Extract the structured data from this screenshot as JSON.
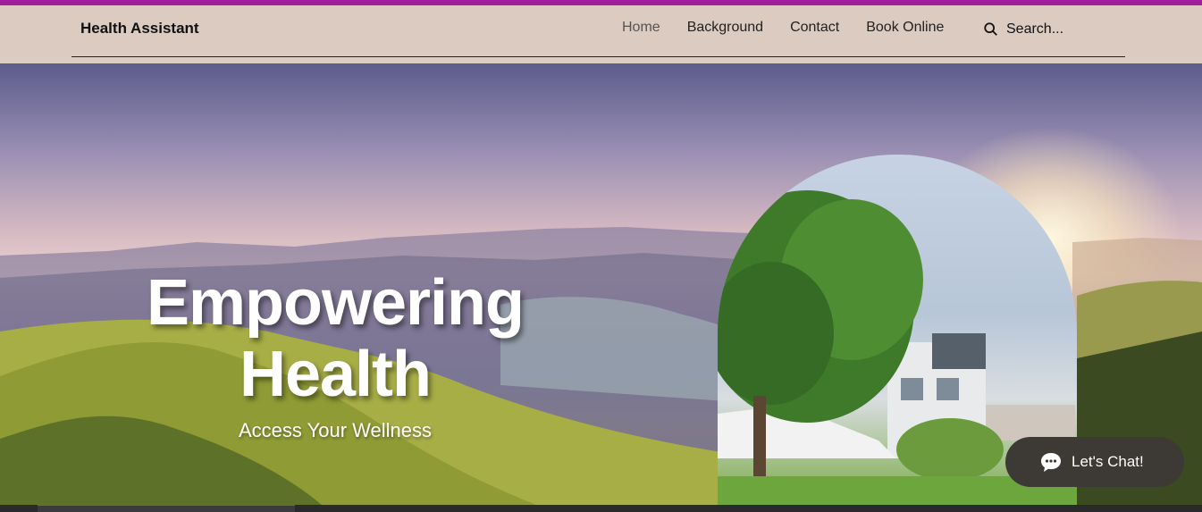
{
  "header": {
    "brand": "Health Assistant",
    "nav": [
      {
        "label": "Home",
        "active": true
      },
      {
        "label": "Background",
        "active": false
      },
      {
        "label": "Contact",
        "active": false
      },
      {
        "label": "Book Online",
        "active": false
      }
    ],
    "search": {
      "placeholder": "Search...",
      "icon": "search-icon"
    }
  },
  "hero": {
    "headline_line1": "Empowering",
    "headline_line2": "Health",
    "subtitle": "Access Your Wellness"
  },
  "chat_widget": {
    "label": "Let's Chat!",
    "icon": "chat-bubble-icon"
  },
  "colors": {
    "accent_bar": "#a020a0",
    "header_bg": "#dccbc0",
    "chat_bg": "#3d3a36"
  }
}
